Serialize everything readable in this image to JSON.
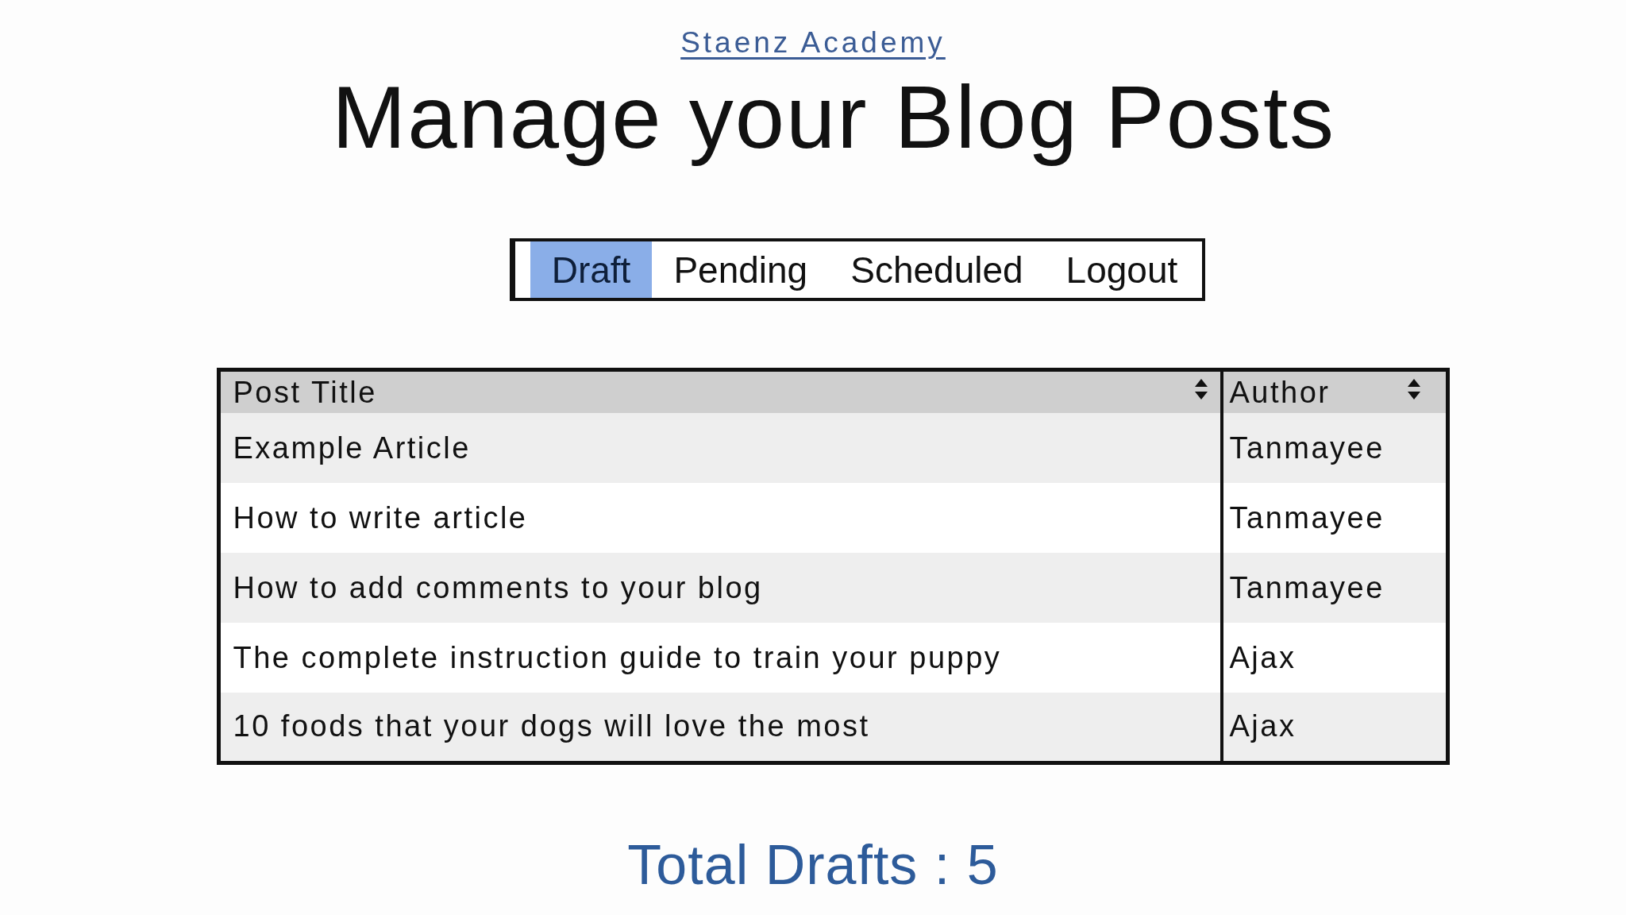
{
  "header_link": "Staenz Academy",
  "title": "Manage your Blog Posts",
  "tabs": [
    {
      "label": "Draft",
      "selected": true
    },
    {
      "label": "Pending",
      "selected": false
    },
    {
      "label": "Scheduled",
      "selected": false
    },
    {
      "label": "Logout",
      "selected": false
    }
  ],
  "table": {
    "columns": [
      {
        "label": "Post Title",
        "sortable": true
      },
      {
        "label": "Author",
        "sortable": true
      }
    ],
    "rows": [
      [
        "Example Article",
        "Tanmayee"
      ],
      [
        "How to write article",
        "Tanmayee"
      ],
      [
        "How to add comments to your blog",
        "Tanmayee"
      ],
      [
        "The complete instruction guide to train your puppy",
        "Ajax"
      ],
      [
        "10 foods that your dogs will love the most",
        "Ajax"
      ]
    ]
  },
  "summary": "Total Drafts : 5"
}
